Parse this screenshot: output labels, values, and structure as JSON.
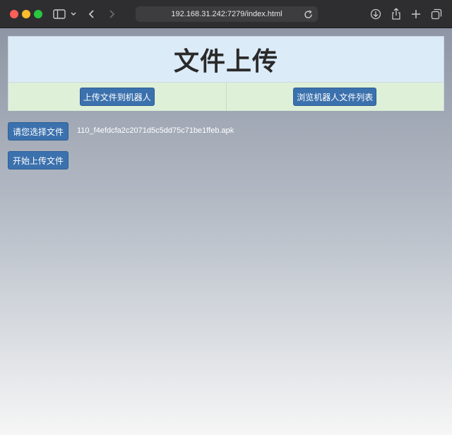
{
  "browser": {
    "url": "192.168.31.242:7279/index.html",
    "icons": [
      "sidebar-icon",
      "chevron-down-icon",
      "back-icon",
      "forward-icon",
      "reload-icon",
      "download-icon",
      "share-icon",
      "new-tab-icon",
      "tabs-overview-icon"
    ]
  },
  "page": {
    "title": "文件上传",
    "nav": {
      "upload_label": "上传文件到机器人",
      "browse_label": "浏览机器人文件列表"
    },
    "form": {
      "choose_label": "请您选择文件",
      "selected_file": "110_f4efdcfa2c2071d5c5dd75c71be1ffeb.apk",
      "start_label": "开始上传文件"
    }
  },
  "colors": {
    "button": "#3b71ad",
    "title_bg": "#dcebf8",
    "nav_bg": "#dff0d9"
  }
}
